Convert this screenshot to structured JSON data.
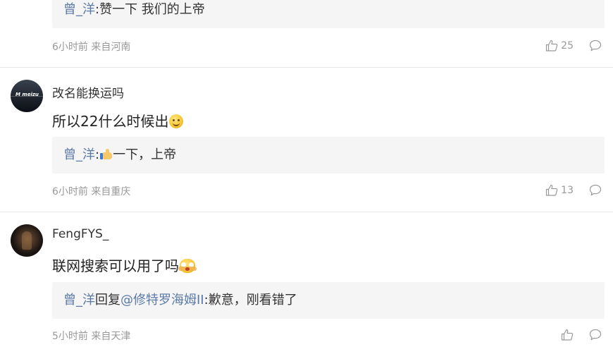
{
  "comments": [
    {
      "reply": {
        "author": "曾_洋",
        "separator": ":",
        "text": "赞一下 我们的上帝"
      },
      "meta": "6小时前 来自河南",
      "likes": "25"
    },
    {
      "username": "改名能换运吗",
      "avatar_icon": "meizu-avatar",
      "text": "所以22什么时候出",
      "emoji": "smile-emoji",
      "reply": {
        "author": "曾_洋",
        "separator": ":",
        "emoji": "thumbs-up-emoji",
        "text": "一下，上帝"
      },
      "meta": "6小时前 来自重庆",
      "likes": "13"
    },
    {
      "username": "FengFYS_",
      "avatar_icon": "dark-portrait-avatar",
      "text": "联网搜索可以用了吗",
      "emoji": "wow-emoji",
      "reply": {
        "author": "曾_洋",
        "action": "回复",
        "mention": "@修特罗海姆II",
        "separator": ":",
        "text": "歉意，刚看错了"
      },
      "meta": "5小时前 来自天津",
      "likes": ""
    }
  ],
  "colors": {
    "link": "#5b7aa8",
    "meta": "#999999",
    "reply_bg": "#f5f5f5",
    "divider": "#e8e8e8"
  },
  "icons": {
    "like": "thumbs-up-icon",
    "comment": "comment-bubble-icon"
  }
}
